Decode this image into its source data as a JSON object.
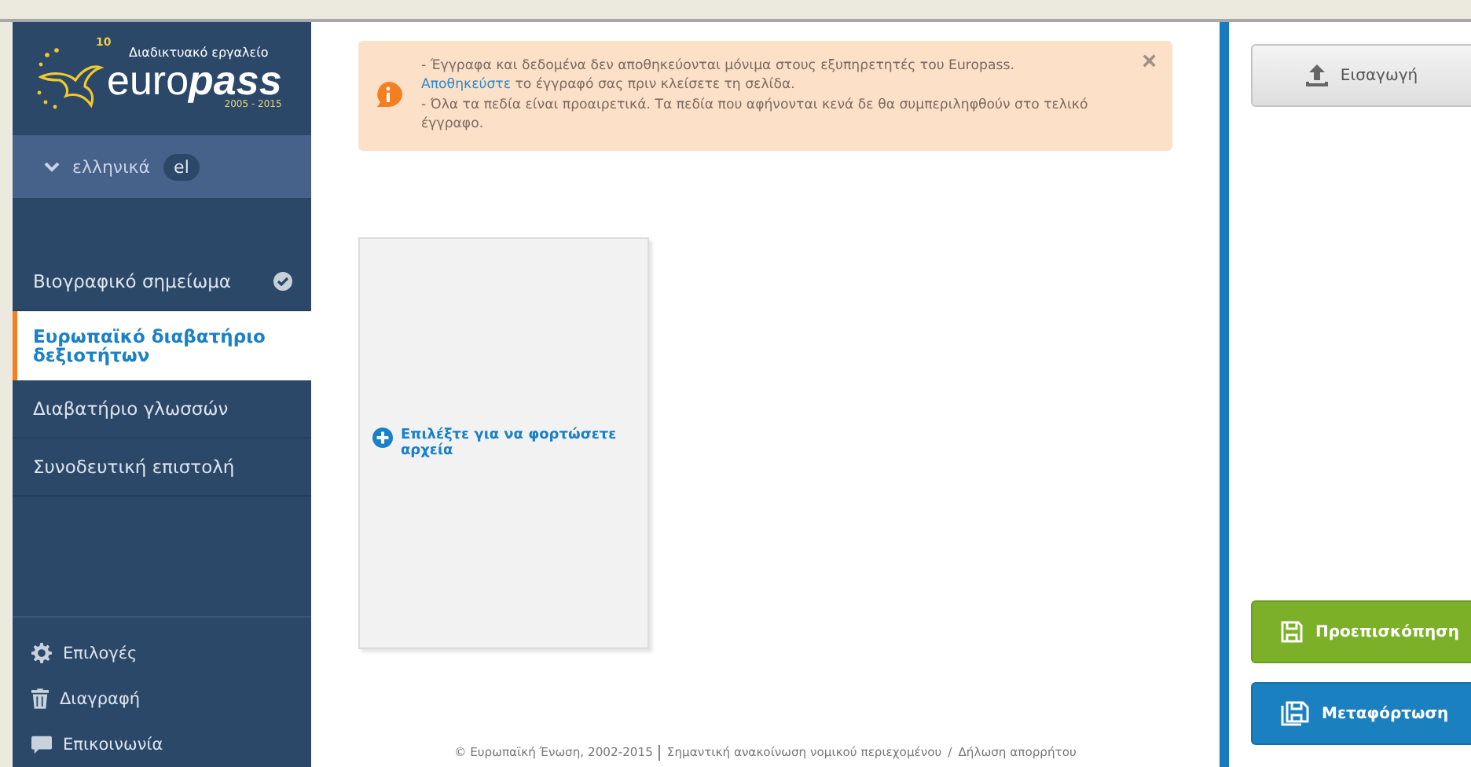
{
  "logo": {
    "tagline": "Διαδικτυακό εργαλείο",
    "word_light": "euro",
    "word_bold": "pass",
    "years": "2005 - 2015",
    "badge": "10"
  },
  "language": {
    "name": "ελληνικά",
    "code": "el",
    "expanded": false
  },
  "nav": [
    {
      "label": "Βιογραφικό σημείωμα",
      "selected": false,
      "completed": true
    },
    {
      "label": "Ευρωπαϊκό διαβατήριο δεξιοτήτων",
      "selected": true,
      "completed": false
    },
    {
      "label": "Διαβατήριο γλωσσών",
      "selected": false,
      "completed": false
    },
    {
      "label": "Συνοδευτική επιστολή",
      "selected": false,
      "completed": false
    }
  ],
  "tools": [
    {
      "kind": "settings",
      "label": "Επιλογές"
    },
    {
      "kind": "delete",
      "label": "Διαγραφή"
    },
    {
      "kind": "contact",
      "label": "Επικοινωνία"
    }
  ],
  "notice": {
    "line1": "- Έγγραφα και δεδομένα δεν αποθηκεύονται μόνιμα στους εξυπηρετητές του Europass.",
    "link": "Αποθηκεύστε",
    "line2": "το έγγραφό σας πριν κλείσετε τη σελίδα.",
    "line3": "- Όλα τα πεδία είναι προαιρετικά. Τα πεδία που αφήνονται κενά δε θα συμπεριληφθούν στο τελικό έγγραφο.",
    "close": "×"
  },
  "upload": {
    "label": "Επιλέξτε για να φορτώσετε αρχεία"
  },
  "footer": {
    "copyright": "© Ευρωπαϊκή Ένωση, 2002-2015",
    "legal": "Σημαντική ανακοίνωση νομικού περιεχομένου",
    "separator": "/",
    "privacy": "Δήλωση απορρήτου"
  },
  "actions": [
    {
      "kind": "import",
      "label": "Εισαγωγή"
    },
    {
      "kind": "preview",
      "label": "Προεπισκόπηση"
    },
    {
      "kind": "download",
      "label": "Μεταφόρτωση"
    }
  ]
}
